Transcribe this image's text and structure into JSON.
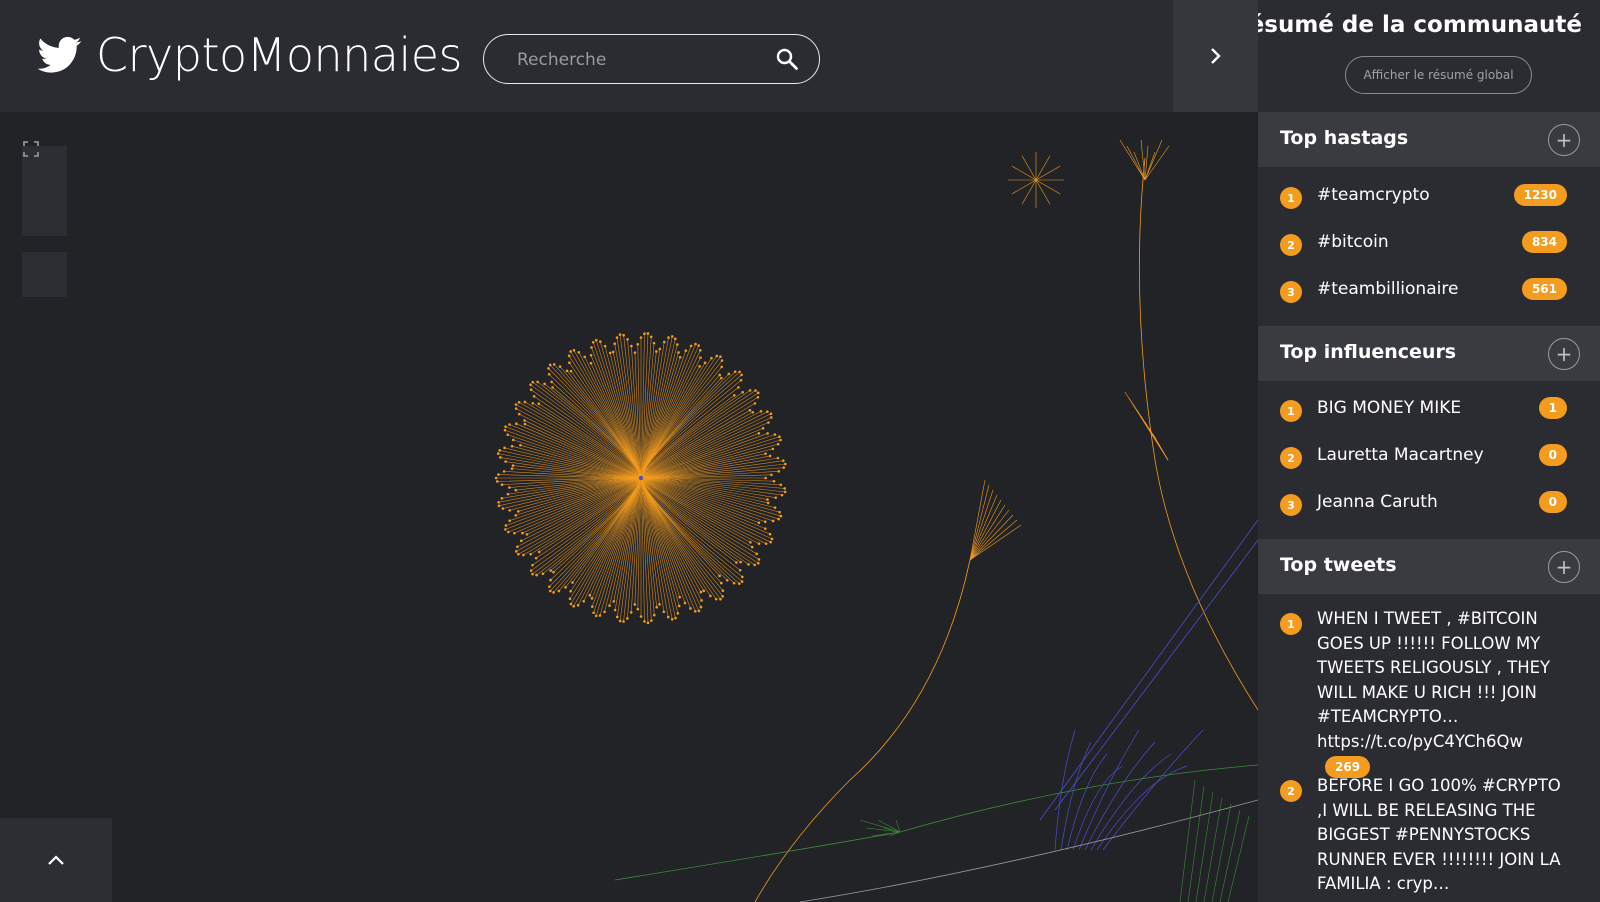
{
  "header": {
    "app_title": "CryptoMonnaies",
    "logo_icon": "twitter-bird-icon",
    "search_placeholder": "Recherche",
    "search_icon": "search-icon",
    "toggle_icon": "chevron-right-icon"
  },
  "graph": {
    "controls": {
      "zoom_in_icon": "plus-icon",
      "zoom_out_icon": "minus-icon",
      "fit_icon": "fullscreen-icon",
      "collapse_icon": "chevron-up-icon"
    },
    "colors": {
      "orange": "#f39c1f",
      "blue": "#4b4fc9",
      "green": "#3d8a3a",
      "grey": "#9a9aa0"
    }
  },
  "sidebar": {
    "title": "Résumé de la communauté",
    "global_button": "Afficher le résumé global",
    "sections": [
      {
        "label": "Top hastags",
        "items": [
          {
            "rank": "1",
            "text": "#teamcrypto",
            "count": "1230"
          },
          {
            "rank": "2",
            "text": "#bitcoin",
            "count": "834"
          },
          {
            "rank": "3",
            "text": "#teambillionaire",
            "count": "561"
          }
        ]
      },
      {
        "label": "Top influenceurs",
        "items": [
          {
            "rank": "1",
            "text": "BIG MONEY MIKE",
            "count": "1"
          },
          {
            "rank": "2",
            "text": "Lauretta Macartney",
            "count": "0"
          },
          {
            "rank": "3",
            "text": "Jeanna Caruth",
            "count": "0"
          }
        ]
      },
      {
        "label": "Top tweets",
        "items": [
          {
            "rank": "1",
            "text": "WHEN I TWEET , #BITCOIN GOES UP !!!!!! FOLLOW MY TWEETS RELIGOUSLY , THEY WILL MAKE U RICH !!! JOIN #TEAMCRYPTO… https://t.co/pyC4YCh6Qw",
            "count": "269"
          },
          {
            "rank": "2",
            "text": "BEFORE I GO 100% #CRYPTO ,I WILL BE RELEASING THE BIGGEST #PENNYSTOCKS RUNNER EVER !!!!!!!! JOIN LA FAMILIA : cryp…",
            "count": ""
          }
        ]
      }
    ],
    "accent": "#f39c1f"
  }
}
